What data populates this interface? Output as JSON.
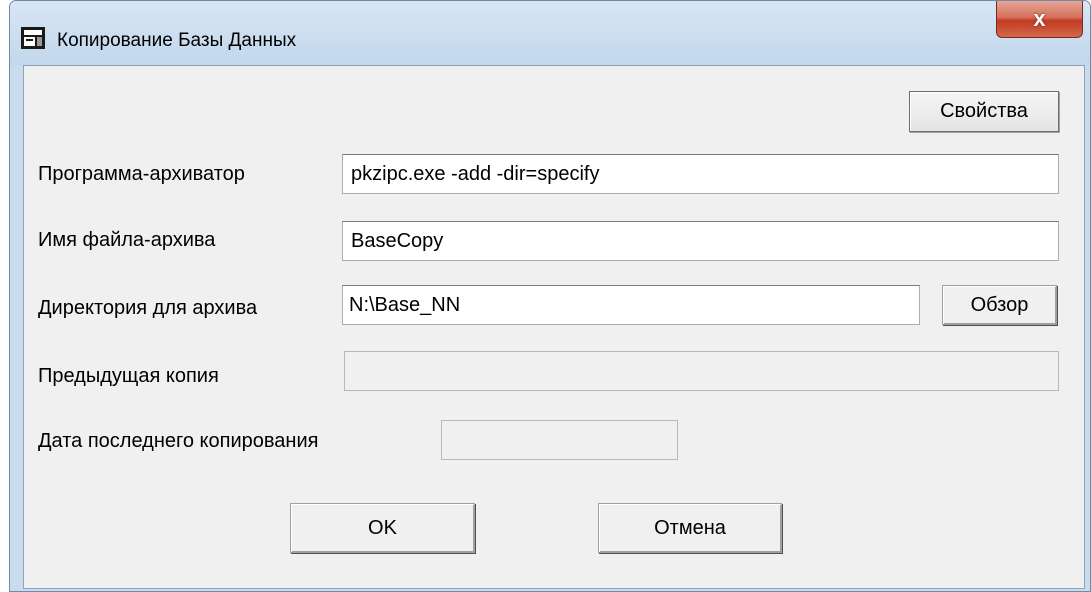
{
  "window": {
    "title": "Копирование Базы Данных",
    "close_glyph": "x",
    "icon": "database-window-icon"
  },
  "toolbar": {
    "properties_label": "Свойства"
  },
  "form": {
    "archiver_label": "Программа-архиватор",
    "archiver_value": "pkzipc.exe -add -dir=specify",
    "archive_name_label": "Имя файла-архива",
    "archive_name_value": "BaseCopy",
    "archive_dir_label": "Директория для архива",
    "archive_dir_value": "N:\\Base_NN",
    "browse_label": "Обзор",
    "previous_copy_label": "Предыдущая копия",
    "previous_copy_value": "",
    "last_copy_date_label": "Дата последнего копирования",
    "last_copy_date_value": ""
  },
  "actions": {
    "ok_label": "OK",
    "cancel_label": "Отмена"
  }
}
